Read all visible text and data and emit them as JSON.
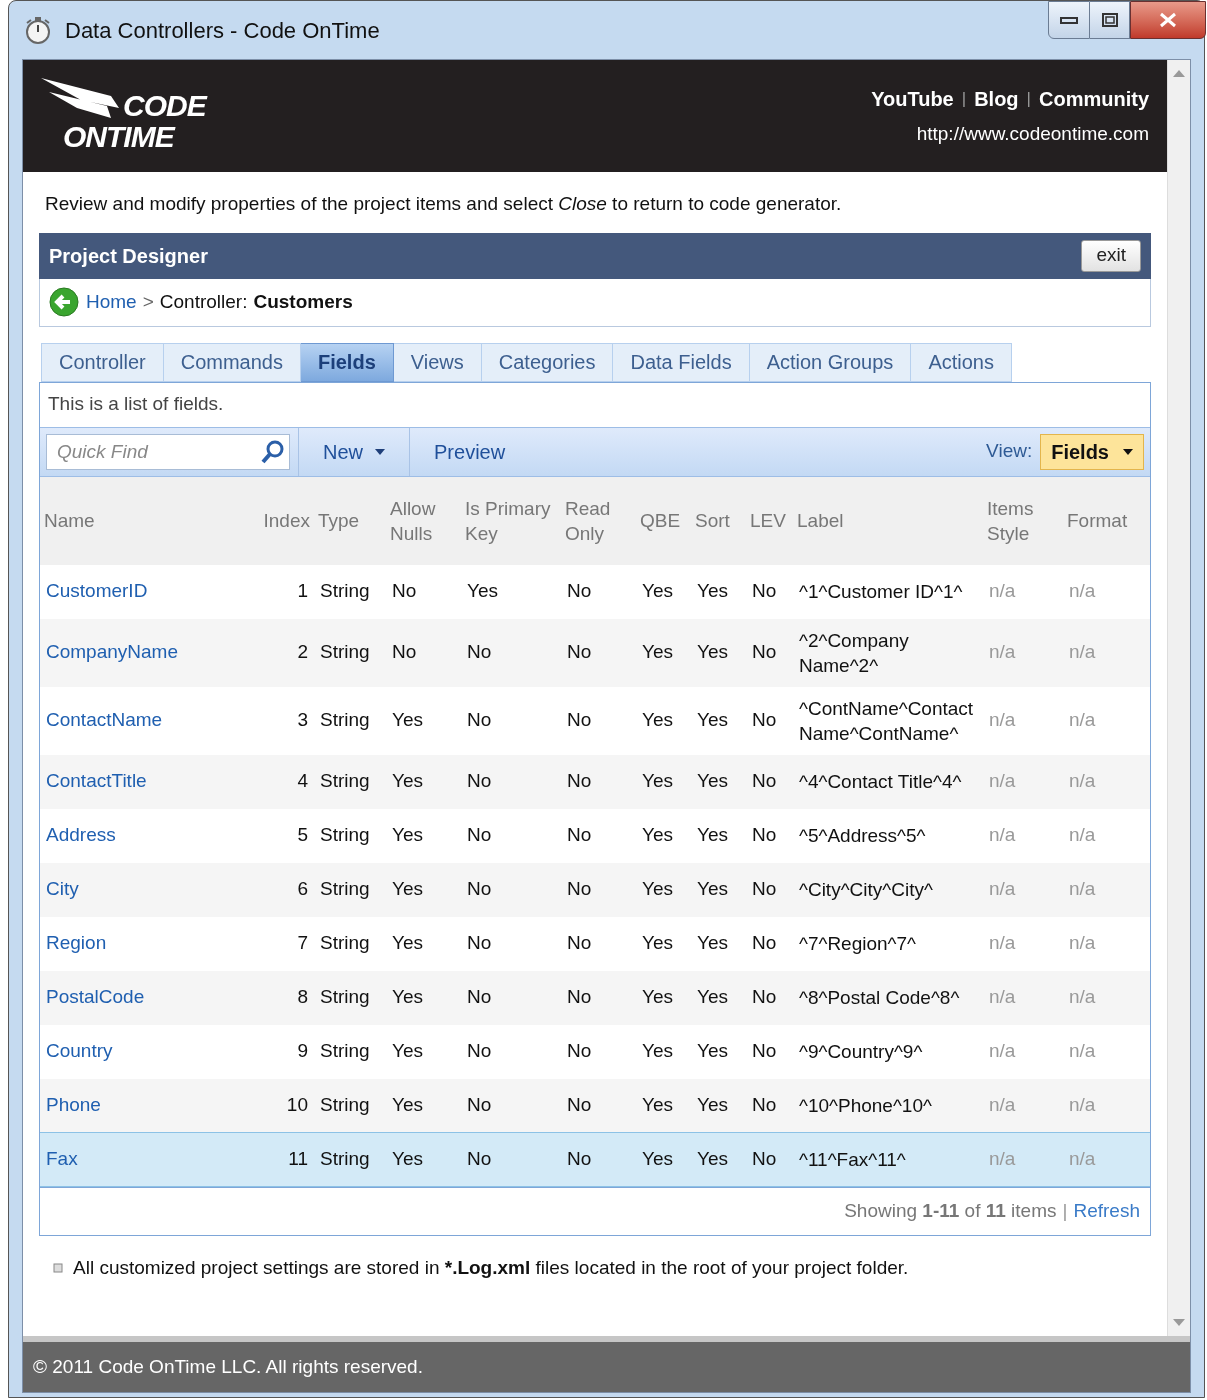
{
  "window": {
    "title": "Data Controllers - Code OnTime"
  },
  "header": {
    "logo_lines": [
      "CODE",
      "ONTIME"
    ],
    "links": [
      "YouTube",
      "Blog",
      "Community"
    ],
    "link_separator": "|",
    "url": "http://www.codeontime.com"
  },
  "intro": "Review and modify properties of the project items and select *Close* to return to code generator.",
  "panel": {
    "title": "Project Designer",
    "exit_button": "exit",
    "breadcrumb": {
      "home": "Home",
      "separator": ">",
      "prefix": "Controller:",
      "current": "Customers"
    }
  },
  "tabs": [
    {
      "label": "Controller",
      "selected": false
    },
    {
      "label": "Commands",
      "selected": false
    },
    {
      "label": "Fields",
      "selected": true
    },
    {
      "label": "Views",
      "selected": false
    },
    {
      "label": "Categories",
      "selected": false
    },
    {
      "label": "Data Fields",
      "selected": false
    },
    {
      "label": "Action Groups",
      "selected": false
    },
    {
      "label": "Actions",
      "selected": false
    }
  ],
  "description": "This is a list of fields.",
  "toolbar": {
    "quick_find": {
      "placeholder": "Quick Find"
    },
    "buttons": [
      {
        "label": "New",
        "kind": "dropdown"
      },
      {
        "label": "Preview",
        "kind": "plain"
      }
    ],
    "view_label": "View:",
    "view_value": "Fields"
  },
  "table": {
    "columns": [
      "Name",
      "Index",
      "Type",
      "Allow Nulls",
      "Is Primary Key",
      "Read Only",
      "QBE",
      "Sort",
      "LEV",
      "Label",
      "Items Style",
      "Format"
    ],
    "rows": [
      {
        "selected": false,
        "cells": [
          "CustomerID",
          "1",
          "String",
          "No",
          "Yes",
          "No",
          "Yes",
          "Yes",
          "No",
          "^1^Customer ID^1^",
          "n/a",
          "n/a"
        ]
      },
      {
        "selected": false,
        "cells": [
          "CompanyName",
          "2",
          "String",
          "No",
          "No",
          "No",
          "Yes",
          "Yes",
          "No",
          "^2^Company Name^2^",
          "n/a",
          "n/a"
        ]
      },
      {
        "selected": false,
        "cells": [
          "ContactName",
          "3",
          "String",
          "Yes",
          "No",
          "No",
          "Yes",
          "Yes",
          "No",
          "^ContName^Contact Name^ContName^",
          "n/a",
          "n/a"
        ]
      },
      {
        "selected": false,
        "cells": [
          "ContactTitle",
          "4",
          "String",
          "Yes",
          "No",
          "No",
          "Yes",
          "Yes",
          "No",
          "^4^Contact Title^4^",
          "n/a",
          "n/a"
        ]
      },
      {
        "selected": false,
        "cells": [
          "Address",
          "5",
          "String",
          "Yes",
          "No",
          "No",
          "Yes",
          "Yes",
          "No",
          "^5^Address^5^",
          "n/a",
          "n/a"
        ]
      },
      {
        "selected": false,
        "cells": [
          "City",
          "6",
          "String",
          "Yes",
          "No",
          "No",
          "Yes",
          "Yes",
          "No",
          "^City^City^City^",
          "n/a",
          "n/a"
        ]
      },
      {
        "selected": false,
        "cells": [
          "Region",
          "7",
          "String",
          "Yes",
          "No",
          "No",
          "Yes",
          "Yes",
          "No",
          "^7^Region^7^",
          "n/a",
          "n/a"
        ]
      },
      {
        "selected": false,
        "cells": [
          "PostalCode",
          "8",
          "String",
          "Yes",
          "No",
          "No",
          "Yes",
          "Yes",
          "No",
          "^8^Postal Code^8^",
          "n/a",
          "n/a"
        ]
      },
      {
        "selected": false,
        "cells": [
          "Country",
          "9",
          "String",
          "Yes",
          "No",
          "No",
          "Yes",
          "Yes",
          "No",
          "^9^Country^9^",
          "n/a",
          "n/a"
        ]
      },
      {
        "selected": false,
        "cells": [
          "Phone",
          "10",
          "String",
          "Yes",
          "No",
          "No",
          "Yes",
          "Yes",
          "No",
          "^10^Phone^10^",
          "n/a",
          "n/a"
        ]
      },
      {
        "selected": true,
        "cells": [
          "Fax",
          "11",
          "String",
          "Yes",
          "No",
          "No",
          "Yes",
          "Yes",
          "No",
          "^11^Fax^11^",
          "n/a",
          "n/a"
        ]
      }
    ]
  },
  "pager": {
    "summary": "Showing **1-11** of **11** items",
    "separator": "|",
    "refresh": "Refresh"
  },
  "note": {
    "before": "All customized project settings are stored in ",
    "bold": "*.Log.xml",
    "after": " files located in the root of your project folder."
  },
  "footer": {
    "copyright": "© 2011 Code OnTime LLC. All rights reserved."
  }
}
